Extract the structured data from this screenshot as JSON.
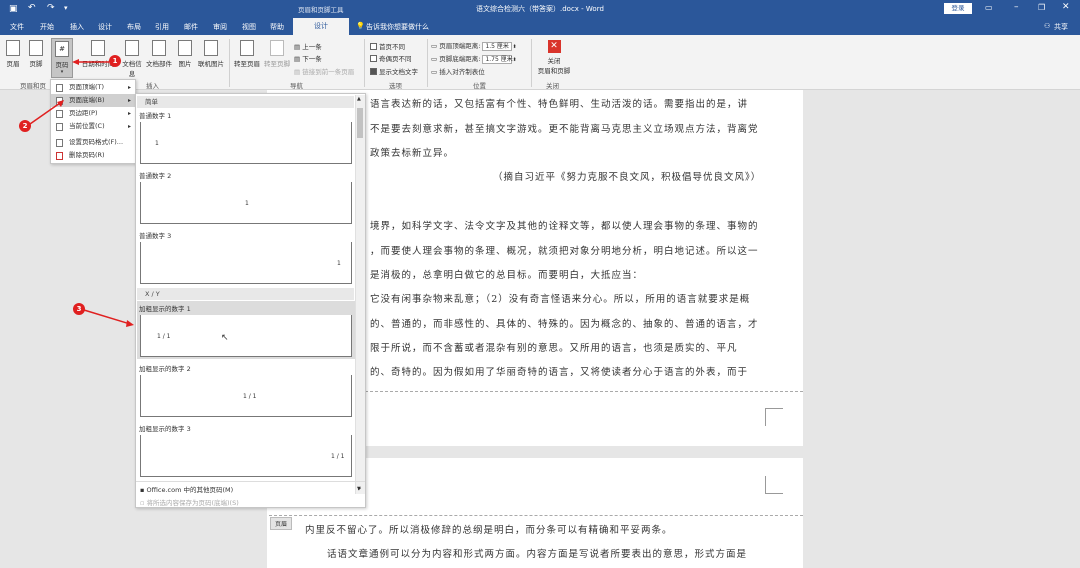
{
  "title_bar": {
    "save_icon": "save-icon",
    "undo_icon": "undo-icon",
    "redo_icon": "redo-icon",
    "qat_more": "▾",
    "context_tool": "页眉和页脚工具",
    "doc_title": "语文综合检测六（带答案）.docx - Word",
    "login": "登录"
  },
  "tabs": [
    "文件",
    "开始",
    "插入",
    "设计",
    "布局",
    "引用",
    "邮件",
    "审阅",
    "视图",
    "帮助"
  ],
  "active_tab": "设计",
  "tell_me": "告诉我你想要做什么",
  "share": "共享",
  "ribbon": {
    "header": "页眉",
    "footer": "页脚",
    "page_number": "页码",
    "date_time": "日期和时间",
    "doc_info": "文档信息",
    "doc_parts": "文档部件",
    "picture": "图片",
    "online_picture": "联机图片",
    "goto_header": "转至页眉",
    "goto_footer": "转至页脚",
    "prev": "上一条",
    "next": "下一条",
    "link_prev": "链接到前一条页眉",
    "diff_first": "首页不同",
    "diff_odd_even": "奇偶页不同",
    "show_text": "显示文档文字",
    "header_top_label": "页眉顶端距离:",
    "header_top_value": "1.5 厘米",
    "footer_bottom_label": "页脚底端距离:",
    "footer_bottom_value": "1.75 厘米",
    "insert_align": "插入对齐制表位",
    "close_line1": "关闭",
    "close_line2": "页眉和页脚",
    "groups": {
      "hf": "页眉和页",
      "insert": "插入",
      "nav": "导航",
      "options": "选项",
      "position": "位置",
      "close": "关闭"
    }
  },
  "page_number_menu": [
    {
      "label": "页面顶端(T)",
      "arrow": "▸"
    },
    {
      "label": "页面底端(B)",
      "arrow": "▸"
    },
    {
      "label": "页边距(P)",
      "arrow": "▸"
    },
    {
      "label": "当前位置(C)",
      "arrow": "▸"
    },
    {
      "label": "设置页码格式(F)..."
    },
    {
      "label": "删除页码(R)"
    }
  ],
  "gallery": {
    "section1": "简单",
    "item1": "普通数字 1",
    "item2": "普通数字 2",
    "item3": "普通数字 3",
    "section2": "X / Y",
    "item4": "加粗显示的数字 1",
    "item5": "加粗显示的数字 2",
    "item6": "加粗显示的数字 3",
    "sample1": "1",
    "sample2": "1",
    "sample3": "1",
    "sample4": "1 / 1",
    "sample5": "1 / 1",
    "sample6": "1 / 1",
    "more": "Office.com 中的其他页码(M)",
    "save_selection": "将所选内容保存为页码(底端)(S)"
  },
  "callouts": [
    "1",
    "2",
    "3"
  ],
  "document": {
    "lines": [
      "语言表达新的话，又包括富有个性、特色鲜明、生动活泼的话。需要指出的是，讲",
      "不是要去刻意求新，甚至搞文字游戏。更不能背离马克思主义立场观点方法，背离党",
      "政策去标新立异。",
      "（摘自习近平《努力克服不良文风，积极倡导优良文风》）",
      "",
      "境界，如科学文字、法令文字及其他的诠释文等，都以使人理会事物的条理、事物的",
      "，而要使人理会事物的条理、概况，就须把对象分明地分析，明白地记述。所以这一",
      "是消极的，总拿明白做它的总目标。而要明白，大抵应当：",
      "它没有闲事杂物来乱意；（2）没有奇言怪语来分心。所以，所用的语言就要求是概",
      "的、普通的，而非感性的、具体的、特殊的。因为概念的、抽象的、普通的语言，才",
      "限于所说，而不含蓄或者混杂有别的意思。又所用的语言，也须是质实的、平凡",
      "的、奇特的。因为假如用了华丽奇特的语言，又将使读者分心于语言的外表，而于"
    ],
    "header_tag": "页眉",
    "page2_lines": [
      "内里反不留心了。所以消极修辞的总纲是明白，而分条可以有精确和平妥两条。",
      "话语文章通例可以分为内容和形式两方面。内容方面是写说者所要表出的意思，形式方面是"
    ]
  }
}
